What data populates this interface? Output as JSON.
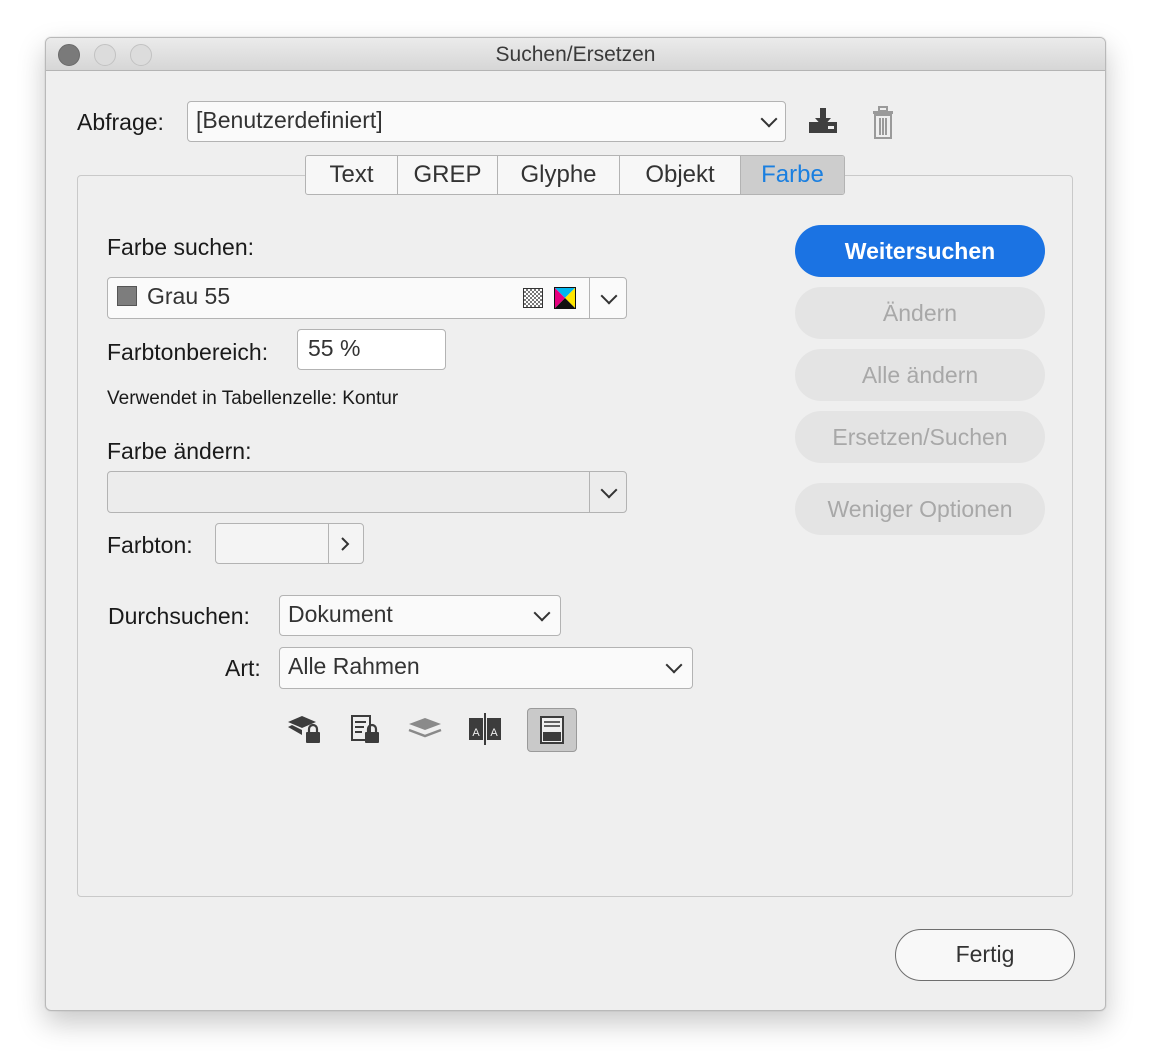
{
  "window": {
    "title": "Suchen/Ersetzen"
  },
  "query": {
    "label": "Abfrage:",
    "value": "[Benutzerdefiniert]"
  },
  "tabs": [
    {
      "label": "Text"
    },
    {
      "label": "GREP"
    },
    {
      "label": "Glyphe"
    },
    {
      "label": "Objekt"
    },
    {
      "label": "Farbe",
      "active": true
    }
  ],
  "find": {
    "label": "Farbe suchen:",
    "color_name": "Grau 55",
    "tint_label": "Farbtonbereich:",
    "tint_value": "55 %",
    "used_in": "Verwendet in Tabellenzelle: Kontur"
  },
  "change": {
    "label": "Farbe ändern:",
    "color_value": "",
    "tint_label": "Farbton:",
    "tint_value": ""
  },
  "search": {
    "label": "Durchsuchen:",
    "value": "Dokument"
  },
  "type": {
    "label": "Art:",
    "value": "Alle Rahmen"
  },
  "buttons": {
    "find_next": "Weitersuchen",
    "change": "Ändern",
    "change_all": "Alle ändern",
    "change_find": "Ersetzen/Suchen",
    "fewer_options": "Weniger Optionen",
    "done": "Fertig"
  },
  "option_icons": [
    {
      "name": "locked-layers-icon",
      "active": false
    },
    {
      "name": "locked-stories-icon",
      "active": false
    },
    {
      "name": "hidden-layers-icon",
      "active": false
    },
    {
      "name": "master-pages-icon",
      "active": false
    },
    {
      "name": "footnotes-icon",
      "active": true
    }
  ],
  "colors": {
    "accent": "#1b73e3",
    "active_tab_text": "#1a7fe0"
  }
}
